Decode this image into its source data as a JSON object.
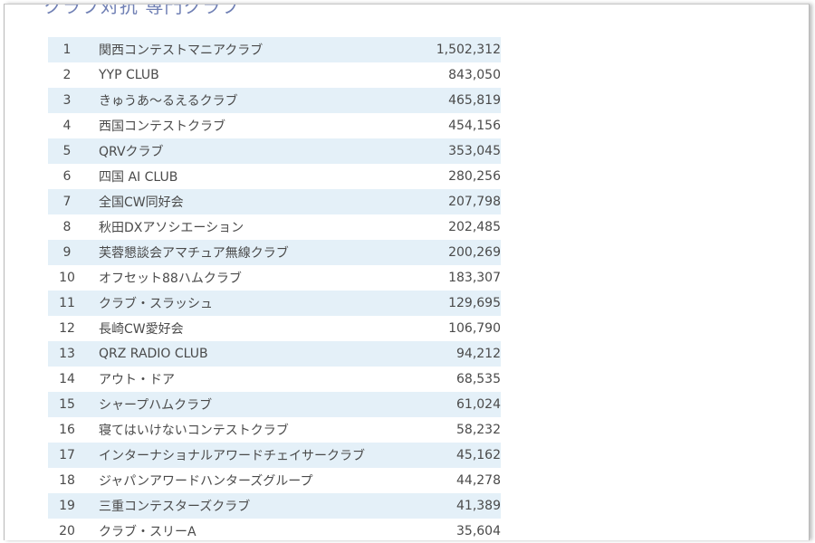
{
  "page": {
    "heading": "クラブ対抗 専門クラブ"
  },
  "ranking": {
    "rows": [
      {
        "rank": "1",
        "name": "関西コンテストマニアクラブ",
        "score": "1,502,312"
      },
      {
        "rank": "2",
        "name": "YYP CLUB",
        "score": "843,050"
      },
      {
        "rank": "3",
        "name": "きゅうあ～るえるクラブ",
        "score": "465,819"
      },
      {
        "rank": "4",
        "name": "西国コンテストクラブ",
        "score": "454,156"
      },
      {
        "rank": "5",
        "name": "QRVクラブ",
        "score": "353,045"
      },
      {
        "rank": "6",
        "name": "四国 AI CLUB",
        "score": "280,256"
      },
      {
        "rank": "7",
        "name": "全国CW同好会",
        "score": "207,798"
      },
      {
        "rank": "8",
        "name": "秋田DXアソシエーション",
        "score": "202,485"
      },
      {
        "rank": "9",
        "name": "芙蓉懇談会アマチュア無線クラブ",
        "score": "200,269"
      },
      {
        "rank": "10",
        "name": "オフセット88ハムクラブ",
        "score": "183,307"
      },
      {
        "rank": "11",
        "name": "クラブ・スラッシュ",
        "score": "129,695"
      },
      {
        "rank": "12",
        "name": "長崎CW愛好会",
        "score": "106,790"
      },
      {
        "rank": "13",
        "name": "QRZ RADIO CLUB",
        "score": "94,212"
      },
      {
        "rank": "14",
        "name": "アウト・ドア",
        "score": "68,535"
      },
      {
        "rank": "15",
        "name": "シャープハムクラブ",
        "score": "61,024"
      },
      {
        "rank": "16",
        "name": "寝てはいけないコンテストクラブ",
        "score": "58,232"
      },
      {
        "rank": "17",
        "name": "インターナショナルアワードチェイサークラブ",
        "score": "45,162"
      },
      {
        "rank": "18",
        "name": "ジャパンアワードハンターズグループ",
        "score": "44,278"
      },
      {
        "rank": "19",
        "name": "三重コンテスターズクラブ",
        "score": "41,389"
      },
      {
        "rank": "20",
        "name": "クラブ・スリーA",
        "score": "35,604"
      }
    ]
  }
}
